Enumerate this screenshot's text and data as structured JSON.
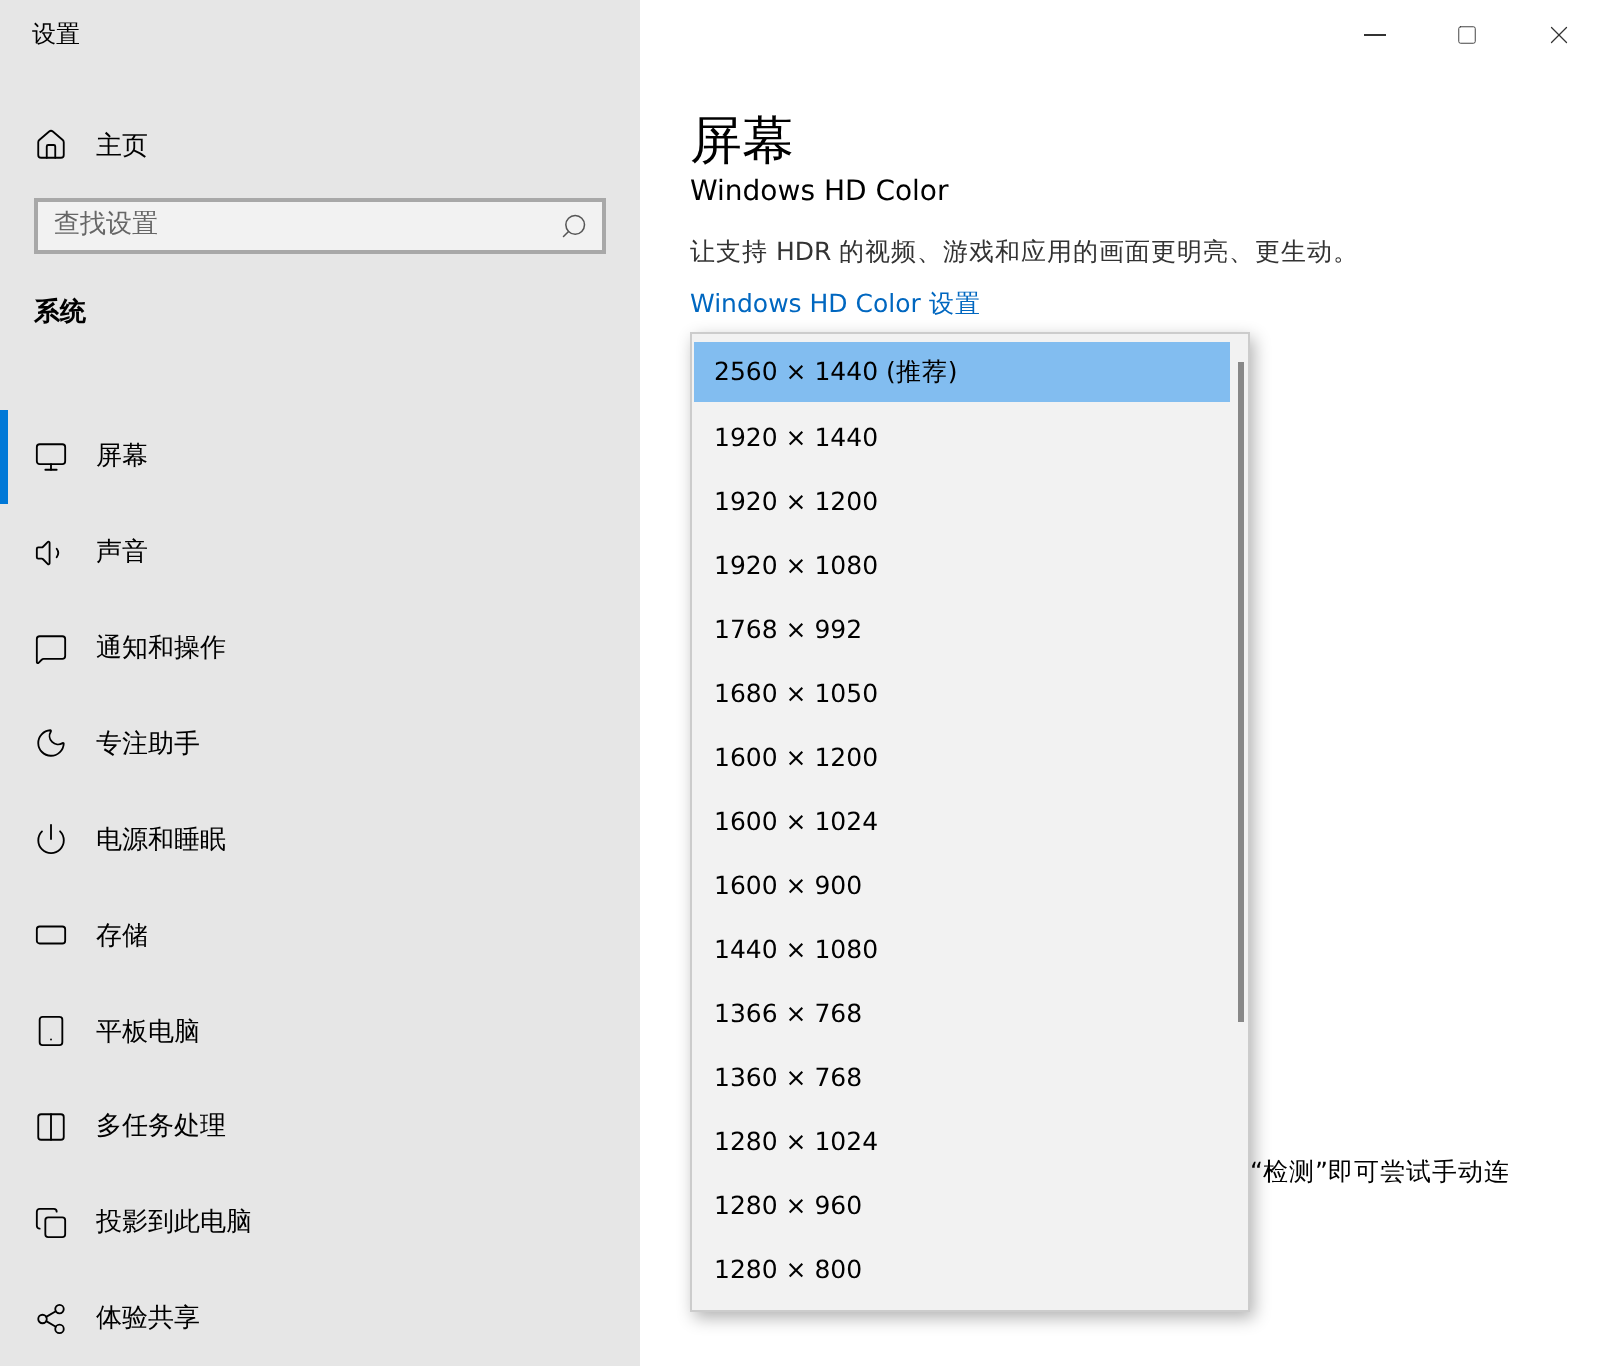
{
  "window": {
    "title": "设置"
  },
  "sidebar": {
    "home": "主页",
    "search": {
      "placeholder": "查找设置"
    },
    "section": "系统",
    "items": [
      {
        "label": "屏幕",
        "selected": true
      },
      {
        "label": "声音",
        "selected": false
      },
      {
        "label": "通知和操作",
        "selected": false
      },
      {
        "label": "专注助手",
        "selected": false
      },
      {
        "label": "电源和睡眠",
        "selected": false
      },
      {
        "label": "存储",
        "selected": false
      },
      {
        "label": "平板电脑",
        "selected": false
      },
      {
        "label": "多任务处理",
        "selected": false
      },
      {
        "label": "投影到此电脑",
        "selected": false
      },
      {
        "label": "体验共享",
        "selected": false
      }
    ]
  },
  "main": {
    "title": "屏幕",
    "heading": "Windows HD Color",
    "description": "让支持 HDR 的视频、游戏和应用的画面更明亮、更生动。",
    "link": "Windows HD Color 设置",
    "partial_text": "“检测”即可尝试手动连"
  },
  "dropdown": {
    "options": [
      {
        "label": "2560 × 1440 (推荐)",
        "selected": true
      },
      {
        "label": "1920 × 1440",
        "selected": false
      },
      {
        "label": "1920 × 1200",
        "selected": false
      },
      {
        "label": "1920 × 1080",
        "selected": false
      },
      {
        "label": "1768 × 992",
        "selected": false
      },
      {
        "label": "1680 × 1050",
        "selected": false
      },
      {
        "label": "1600 × 1200",
        "selected": false
      },
      {
        "label": "1600 × 1024",
        "selected": false
      },
      {
        "label": "1600 × 900",
        "selected": false
      },
      {
        "label": "1440 × 1080",
        "selected": false
      },
      {
        "label": "1366 × 768",
        "selected": false
      },
      {
        "label": "1360 × 768",
        "selected": false
      },
      {
        "label": "1280 × 1024",
        "selected": false
      },
      {
        "label": "1280 × 960",
        "selected": false
      },
      {
        "label": "1280 × 800",
        "selected": false
      }
    ]
  }
}
